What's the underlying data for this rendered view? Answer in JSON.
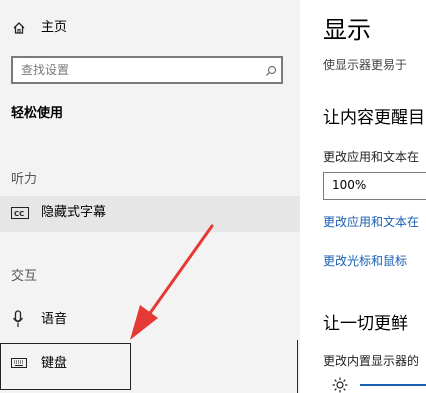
{
  "sidebar": {
    "home_label": "主页",
    "search_placeholder": "查找设置",
    "category_title": "轻松使用",
    "section_hearing": "听力",
    "item_captions": "隐藏式字幕",
    "section_interaction": "交互",
    "item_speech": "语音",
    "item_keyboard": "键盘"
  },
  "main": {
    "title": "显示",
    "subtitle": "使显示器更易于",
    "heading_text_size": "让内容更醒目",
    "label_change_text": "更改应用和文本在",
    "text_scale_value": "100%",
    "link_change_text": "更改应用和文本在",
    "link_change_cursor": "更改光标和鼠标",
    "heading_brightness": "让一切更鲜",
    "label_brightness": "更改内置显示器的"
  },
  "colors": {
    "sidebar_bg": "#f3f3f3",
    "accent": "#1a5fb4",
    "arrow": "#e53935"
  }
}
